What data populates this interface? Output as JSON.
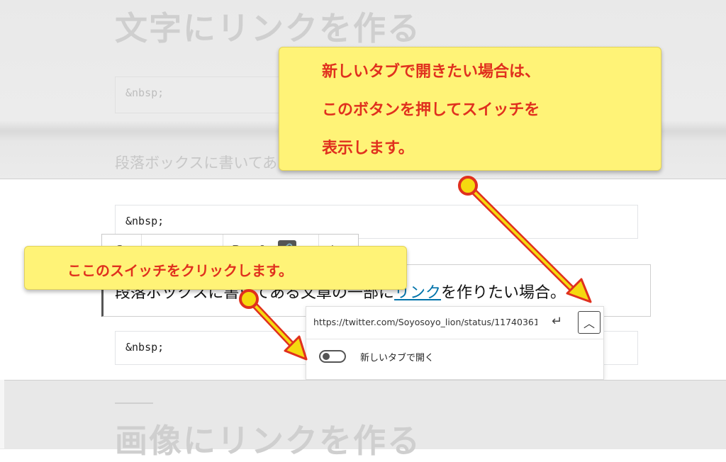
{
  "background": {
    "heading_top": "文字にリンクを作る",
    "nbsp_top": "&nbsp;",
    "paragraph_dim": "段落ボックスに書いてある文章の一部にリンクを作りたい場合。",
    "heading_bottom": "画像にリンクを作る"
  },
  "editor": {
    "nbsp_1": "&nbsp;",
    "nbsp_2": "&nbsp;",
    "toolbar": {
      "paragraph_icon": "¶",
      "align_left_icon": "≡",
      "align_center_icon": "≡",
      "align_right_icon": "≡",
      "bold": "B",
      "italic": "I",
      "link_icon": "🔗",
      "chevron": "▾",
      "more": "⋮"
    },
    "paragraph": {
      "before_link": "段落ボックスに書いてある文章の一部に",
      "link_text": "リンク",
      "after_link": "を作りたい場合。"
    }
  },
  "link_popover": {
    "url": "https://twitter.com/Soyosoyo_lion/status/11740361",
    "submit_icon": "↵",
    "expand_icon": "︿",
    "new_tab_label": "新しいタブで開く",
    "new_tab_enabled": false
  },
  "callouts": {
    "top": {
      "line1": "新しいタブで開きたい場合は、",
      "line2": "このボタンを押してスイッチを",
      "line3": "表示します。"
    },
    "left": "ここのスイッチをクリックします。"
  },
  "colors": {
    "callout_fill": "#fff377",
    "callout_text": "#e0301e",
    "arrow_fill": "#f5d90f",
    "arrow_stroke": "#e0301e",
    "link": "#0073aa"
  }
}
